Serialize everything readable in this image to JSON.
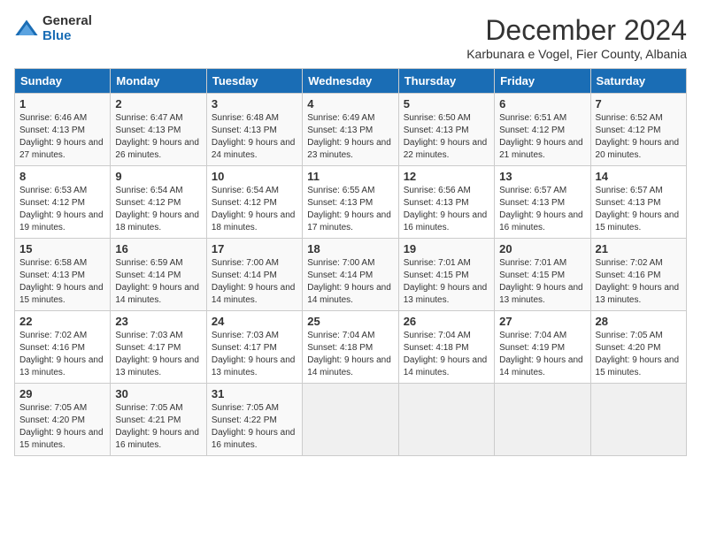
{
  "logo": {
    "general": "General",
    "blue": "Blue"
  },
  "title": "December 2024",
  "subtitle": "Karbunara e Vogel, Fier County, Albania",
  "days": [
    "Sunday",
    "Monday",
    "Tuesday",
    "Wednesday",
    "Thursday",
    "Friday",
    "Saturday"
  ],
  "weeks": [
    [
      {
        "day": "1",
        "sunrise": "6:46 AM",
        "sunset": "4:13 PM",
        "daylight": "9 hours and 27 minutes."
      },
      {
        "day": "2",
        "sunrise": "6:47 AM",
        "sunset": "4:13 PM",
        "daylight": "9 hours and 26 minutes."
      },
      {
        "day": "3",
        "sunrise": "6:48 AM",
        "sunset": "4:13 PM",
        "daylight": "9 hours and 24 minutes."
      },
      {
        "day": "4",
        "sunrise": "6:49 AM",
        "sunset": "4:13 PM",
        "daylight": "9 hours and 23 minutes."
      },
      {
        "day": "5",
        "sunrise": "6:50 AM",
        "sunset": "4:13 PM",
        "daylight": "9 hours and 22 minutes."
      },
      {
        "day": "6",
        "sunrise": "6:51 AM",
        "sunset": "4:12 PM",
        "daylight": "9 hours and 21 minutes."
      },
      {
        "day": "7",
        "sunrise": "6:52 AM",
        "sunset": "4:12 PM",
        "daylight": "9 hours and 20 minutes."
      }
    ],
    [
      {
        "day": "8",
        "sunrise": "6:53 AM",
        "sunset": "4:12 PM",
        "daylight": "9 hours and 19 minutes."
      },
      {
        "day": "9",
        "sunrise": "6:54 AM",
        "sunset": "4:12 PM",
        "daylight": "9 hours and 18 minutes."
      },
      {
        "day": "10",
        "sunrise": "6:54 AM",
        "sunset": "4:12 PM",
        "daylight": "9 hours and 18 minutes."
      },
      {
        "day": "11",
        "sunrise": "6:55 AM",
        "sunset": "4:13 PM",
        "daylight": "9 hours and 17 minutes."
      },
      {
        "day": "12",
        "sunrise": "6:56 AM",
        "sunset": "4:13 PM",
        "daylight": "9 hours and 16 minutes."
      },
      {
        "day": "13",
        "sunrise": "6:57 AM",
        "sunset": "4:13 PM",
        "daylight": "9 hours and 16 minutes."
      },
      {
        "day": "14",
        "sunrise": "6:57 AM",
        "sunset": "4:13 PM",
        "daylight": "9 hours and 15 minutes."
      }
    ],
    [
      {
        "day": "15",
        "sunrise": "6:58 AM",
        "sunset": "4:13 PM",
        "daylight": "9 hours and 15 minutes."
      },
      {
        "day": "16",
        "sunrise": "6:59 AM",
        "sunset": "4:14 PM",
        "daylight": "9 hours and 14 minutes."
      },
      {
        "day": "17",
        "sunrise": "7:00 AM",
        "sunset": "4:14 PM",
        "daylight": "9 hours and 14 minutes."
      },
      {
        "day": "18",
        "sunrise": "7:00 AM",
        "sunset": "4:14 PM",
        "daylight": "9 hours and 14 minutes."
      },
      {
        "day": "19",
        "sunrise": "7:01 AM",
        "sunset": "4:15 PM",
        "daylight": "9 hours and 13 minutes."
      },
      {
        "day": "20",
        "sunrise": "7:01 AM",
        "sunset": "4:15 PM",
        "daylight": "9 hours and 13 minutes."
      },
      {
        "day": "21",
        "sunrise": "7:02 AM",
        "sunset": "4:16 PM",
        "daylight": "9 hours and 13 minutes."
      }
    ],
    [
      {
        "day": "22",
        "sunrise": "7:02 AM",
        "sunset": "4:16 PM",
        "daylight": "9 hours and 13 minutes."
      },
      {
        "day": "23",
        "sunrise": "7:03 AM",
        "sunset": "4:17 PM",
        "daylight": "9 hours and 13 minutes."
      },
      {
        "day": "24",
        "sunrise": "7:03 AM",
        "sunset": "4:17 PM",
        "daylight": "9 hours and 13 minutes."
      },
      {
        "day": "25",
        "sunrise": "7:04 AM",
        "sunset": "4:18 PM",
        "daylight": "9 hours and 14 minutes."
      },
      {
        "day": "26",
        "sunrise": "7:04 AM",
        "sunset": "4:18 PM",
        "daylight": "9 hours and 14 minutes."
      },
      {
        "day": "27",
        "sunrise": "7:04 AM",
        "sunset": "4:19 PM",
        "daylight": "9 hours and 14 minutes."
      },
      {
        "day": "28",
        "sunrise": "7:05 AM",
        "sunset": "4:20 PM",
        "daylight": "9 hours and 15 minutes."
      }
    ],
    [
      {
        "day": "29",
        "sunrise": "7:05 AM",
        "sunset": "4:20 PM",
        "daylight": "9 hours and 15 minutes."
      },
      {
        "day": "30",
        "sunrise": "7:05 AM",
        "sunset": "4:21 PM",
        "daylight": "9 hours and 16 minutes."
      },
      {
        "day": "31",
        "sunrise": "7:05 AM",
        "sunset": "4:22 PM",
        "daylight": "9 hours and 16 minutes."
      },
      null,
      null,
      null,
      null
    ]
  ]
}
